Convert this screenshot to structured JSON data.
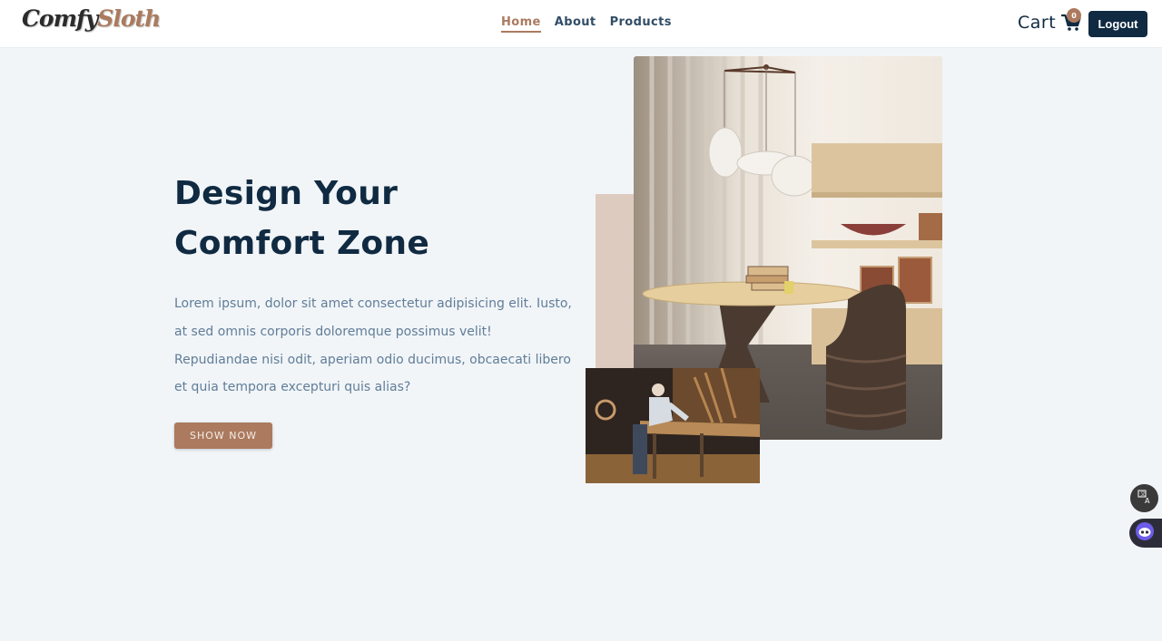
{
  "brand": {
    "part1": "Comfy",
    "part2": "Sloth"
  },
  "nav": {
    "links": [
      {
        "label": "Home",
        "active": true
      },
      {
        "label": "About",
        "active": false
      },
      {
        "label": "Products",
        "active": false
      }
    ]
  },
  "cart": {
    "label": "Cart",
    "count": "0",
    "icon": "cart-icon"
  },
  "auth": {
    "logout_label": "Logout"
  },
  "hero": {
    "title_line1": "Design Your",
    "title_line2": "Comfort Zone",
    "text": "Lorem ipsum, dolor sit amet consectetur adipisicing elit. Iusto, at sed omnis corporis doloremque possimus velit! Repudiandae nisi odit, aperiam odio ducimus, obcaecati libero et quia tempora excepturi quis alias?",
    "button_label": "SHOW NOW"
  },
  "images": {
    "main": "dining-room-photo",
    "accent": "carpenter-workshop-photo"
  },
  "widgets": {
    "translate_icon": "translate-icon",
    "bot_icon": "chatbot-icon"
  },
  "colors": {
    "brand": "#ab7a5f",
    "dark": "#102a42",
    "text": "#617d98",
    "background": "#f1f5f8",
    "accent_block": "#decbc0"
  }
}
